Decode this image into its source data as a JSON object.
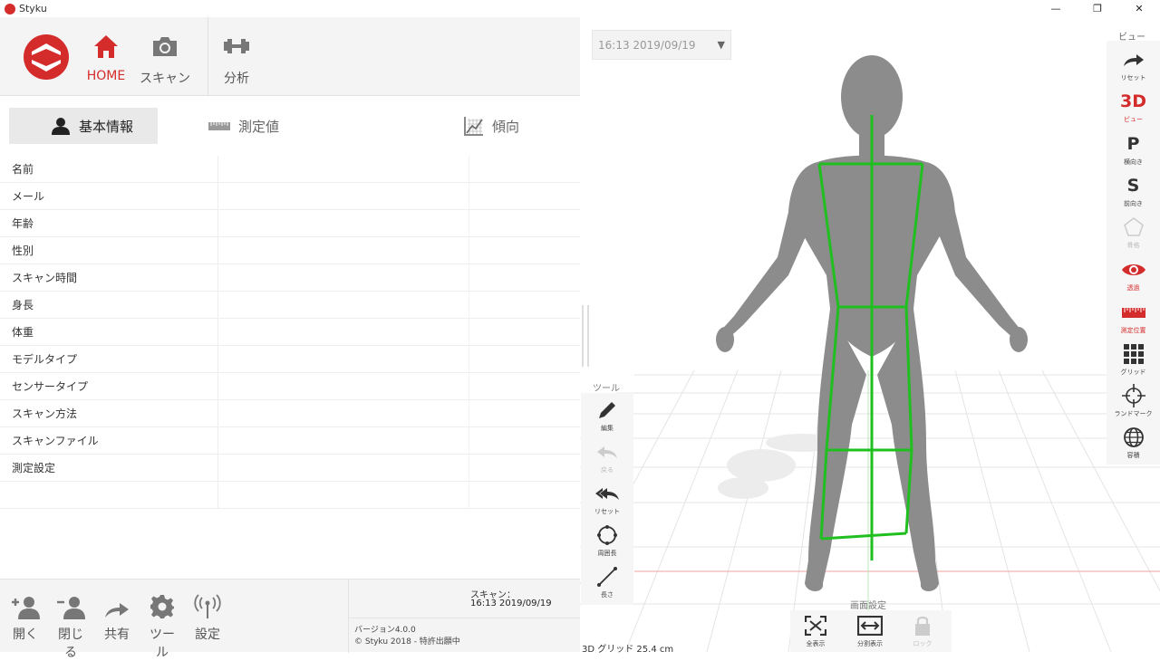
{
  "window": {
    "title": "Styku",
    "minimize": "—",
    "maximize": "❐",
    "close": "✕"
  },
  "nav": {
    "home": "HOME",
    "scan": "スキャン",
    "analysis": "分析"
  },
  "tabs": {
    "basic_info": "基本情報",
    "measurements": "測定値",
    "trends": "傾向"
  },
  "info_rows": [
    {
      "label": "名前",
      "value": ""
    },
    {
      "label": "メール",
      "value": ""
    },
    {
      "label": "年齢",
      "value": ""
    },
    {
      "label": "性別",
      "value": ""
    },
    {
      "label": "スキャン時間",
      "value": ""
    },
    {
      "label": "身長",
      "value": ""
    },
    {
      "label": "体重",
      "value": ""
    },
    {
      "label": "モデルタイプ",
      "value": ""
    },
    {
      "label": "センサータイプ",
      "value": ""
    },
    {
      "label": "スキャン方法",
      "value": ""
    },
    {
      "label": "スキャンファイル",
      "value": ""
    },
    {
      "label": "測定設定",
      "value": ""
    },
    {
      "label": "",
      "value": ""
    }
  ],
  "bottom_toolbar": {
    "open": "開く",
    "close": "閉じる",
    "share": "共有",
    "tools": "ツール",
    "settings": "設定"
  },
  "scan_info": {
    "label": "スキャン：",
    "datetime": "16:13 2019/09/19",
    "version": "バージョン4.0.0",
    "copyright": "© Styku 2018 - 特許出願中"
  },
  "viewport": {
    "scan_selector": "16:13 2019/09/19",
    "grid_label": "3D グリッド 25.4 cm"
  },
  "view_panel": {
    "title": "ビュー",
    "reset_label": "リセット",
    "view3d_glyph": "3D",
    "view3d_label": "ビュー",
    "profile_glyph": "P",
    "profile_label": "横向き",
    "side_glyph": "S",
    "side_label": "前向き",
    "skeleton_label": "骨格",
    "transparent_label": "透過",
    "measure_label": "測定位置",
    "grid_label": "グリッド",
    "landmark_label": "ランドマーク",
    "volume_label": "容積"
  },
  "tool_panel": {
    "title": "ツール",
    "edit": "編集",
    "undo": "戻る",
    "reset": "リセット",
    "circumference": "周囲長",
    "length": "長さ"
  },
  "screen_panel": {
    "title": "画面設定",
    "fit_all": "全表示",
    "split": "分割表示",
    "lock": "ロック"
  },
  "colors": {
    "accent": "#d42b2b",
    "skeleton": "#1fbf1f",
    "model": "#8c8c8c"
  }
}
